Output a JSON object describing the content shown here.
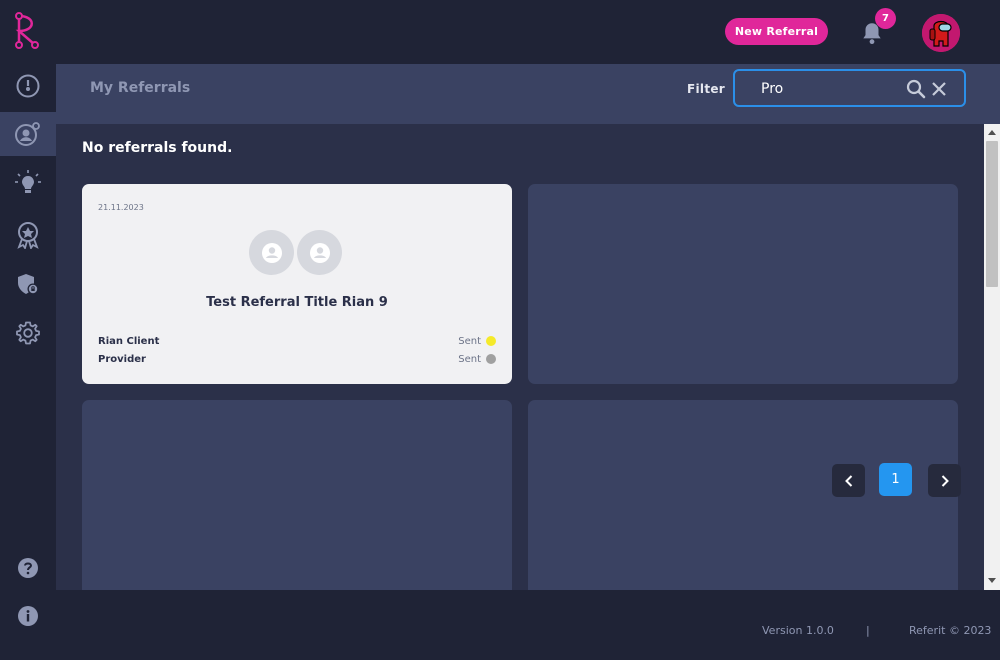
{
  "topbar": {
    "new_referral_label": "New Referral",
    "notification_count": "7"
  },
  "sidebar": {
    "items": [
      {
        "icon": "dashboard-gauge-icon"
      },
      {
        "icon": "referrals-user-icon",
        "active": true
      },
      {
        "icon": "lightbulb-icon"
      },
      {
        "icon": "award-badge-icon"
      },
      {
        "icon": "shield-lock-icon"
      },
      {
        "icon": "settings-gear-icon"
      }
    ],
    "bottom_items": [
      {
        "icon": "help-icon"
      },
      {
        "icon": "info-icon"
      }
    ]
  },
  "header": {
    "title": "My Referrals",
    "filter_label": "Filter",
    "filter_value": "Pro"
  },
  "main": {
    "empty_message": "No referrals found.",
    "cards": [
      {
        "date": "21.11.2023",
        "title": "Test Referral Title Rian 9",
        "parties": [
          {
            "name": "Rian Client",
            "status": "Sent",
            "dot_color": "#f5ea2a"
          },
          {
            "name": "Provider",
            "status": "Sent",
            "dot_color": "#a0a0a0"
          }
        ]
      }
    ]
  },
  "pagination": {
    "current_page": "1"
  },
  "footer": {
    "version": "Version 1.0.0",
    "divider": "|",
    "copyright": "Referit © 2023"
  },
  "colors": {
    "brand_pink": "#e0279a",
    "accent_blue": "#2496f0",
    "panel": "#3a4262",
    "background": "#1f2336"
  }
}
